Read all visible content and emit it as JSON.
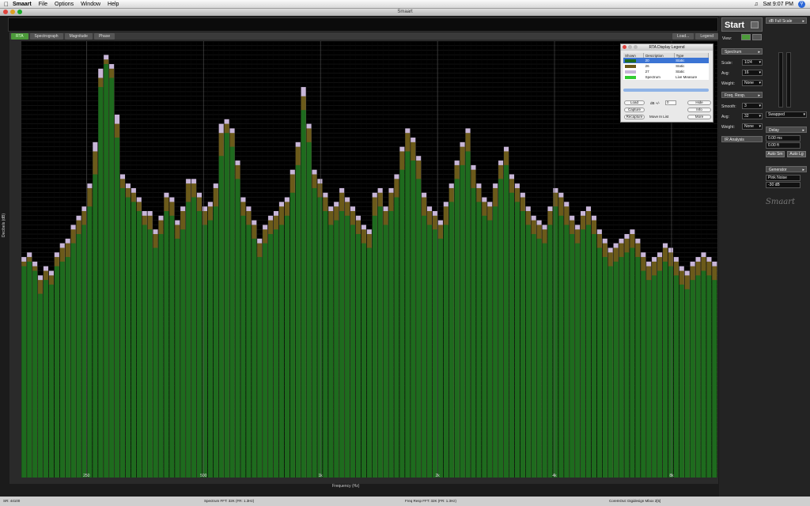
{
  "menubar": {
    "app": "Smaart",
    "items": [
      "File",
      "Options",
      "Window",
      "Help"
    ],
    "clock": "Sat 9:07 PM"
  },
  "window": {
    "title": "Smaart"
  },
  "tabs": {
    "items": [
      "RTA",
      "Spectrograph",
      "Magnitude",
      "Phase"
    ],
    "right": [
      "Load...",
      "Legend"
    ]
  },
  "plot": {
    "ylabel": "Decibels (dB)",
    "xlabel": "Frequency (Hz)",
    "xticks": [
      {
        "label": "250",
        "freq": 250
      },
      {
        "label": "500",
        "freq": 500
      },
      {
        "label": "1k",
        "freq": 1000
      },
      {
        "label": "2k",
        "freq": 2000
      },
      {
        "label": "4k",
        "freq": 4000
      },
      {
        "label": "8k",
        "freq": 8000
      }
    ]
  },
  "chart_data": {
    "type": "bar",
    "xscale": "log",
    "xlim": [
      170,
      10500
    ],
    "ylim": [
      -95,
      0
    ],
    "grid": true,
    "series": [
      {
        "name": "20",
        "color": "#1e6b1e"
      },
      {
        "name": "26",
        "color": "#6b5a1a"
      },
      {
        "name": "27",
        "color": "#c8b6d8"
      },
      {
        "name": "Spectrum",
        "color": "#33cc33"
      }
    ],
    "values_db": [
      -49,
      -48,
      -50,
      -55,
      -52,
      -53,
      -49,
      -48,
      -47,
      -44,
      -42,
      -40,
      -36,
      -29,
      -10,
      -5,
      -8,
      -21,
      -32,
      -34,
      -35,
      -37,
      -40,
      -41,
      -45,
      -42,
      -37,
      -38,
      -43,
      -41,
      -35,
      -34,
      -37,
      -40,
      -39,
      -36,
      -25,
      -20,
      -23,
      -30,
      -38,
      -40,
      -43,
      -47,
      -44,
      -42,
      -41,
      -40,
      -38,
      -33,
      -27,
      -15,
      -22,
      -32,
      -34,
      -37,
      -40,
      -39,
      -37,
      -38,
      -40,
      -42,
      -44,
      -45,
      -38,
      -36,
      -40,
      -37,
      -34,
      -28,
      -24,
      -26,
      -30,
      -38,
      -40,
      -41,
      -43,
      -40,
      -35,
      -30,
      -27,
      -24,
      -32,
      -35,
      -38,
      -39,
      -36,
      -30,
      -27,
      -33,
      -35,
      -37,
      -40,
      -42,
      -43,
      -44,
      -40,
      -36,
      -38,
      -40,
      -42,
      -44,
      -41,
      -40,
      -42,
      -45,
      -47,
      -49,
      -48,
      -47,
      -46,
      -45,
      -47,
      -50,
      -52,
      -51,
      -50,
      -48,
      -49,
      -51,
      -53,
      -54,
      -52,
      -51,
      -50,
      -51,
      -52
    ],
    "olive_db": [
      -48,
      -47,
      -49,
      -52,
      -50,
      -51,
      -47,
      -45,
      -44,
      -41,
      -39,
      -37,
      -32,
      -24,
      -8,
      -4,
      -6,
      -18,
      -30,
      -32,
      -33,
      -35,
      -38,
      -38,
      -42,
      -39,
      -34,
      -35,
      -40,
      -37,
      -31,
      -31,
      -34,
      -37,
      -36,
      -32,
      -20,
      -18,
      -20,
      -27,
      -35,
      -37,
      -40,
      -44,
      -41,
      -39,
      -38,
      -36,
      -35,
      -29,
      -23,
      -12,
      -19,
      -29,
      -31,
      -34,
      -37,
      -36,
      -33,
      -35,
      -37,
      -39,
      -41,
      -42,
      -34,
      -33,
      -37,
      -33,
      -30,
      -24,
      -20,
      -22,
      -26,
      -34,
      -37,
      -38,
      -40,
      -36,
      -32,
      -27,
      -23,
      -20,
      -28,
      -32,
      -35,
      -36,
      -32,
      -27,
      -24,
      -30,
      -32,
      -34,
      -37,
      -39,
      -40,
      -41,
      -37,
      -33,
      -34,
      -36,
      -39,
      -41,
      -38,
      -37,
      -39,
      -42,
      -44,
      -46,
      -45,
      -44,
      -43,
      -42,
      -44,
      -47,
      -49,
      -48,
      -47,
      -45,
      -46,
      -48,
      -50,
      -51,
      -49,
      -48,
      -47,
      -48,
      -49
    ],
    "peak_db": [
      -47,
      -46,
      -48,
      -51,
      -49,
      -50,
      -46,
      -44,
      -43,
      -40,
      -38,
      -36,
      -31,
      -22,
      -6,
      -3,
      -5,
      -16,
      -29,
      -31,
      -32,
      -34,
      -37,
      -37,
      -41,
      -38,
      -33,
      -34,
      -39,
      -36,
      -30,
      -30,
      -33,
      -36,
      -35,
      -31,
      -18,
      -17,
      -19,
      -26,
      -34,
      -36,
      -39,
      -43,
      -40,
      -38,
      -37,
      -35,
      -34,
      -28,
      -22,
      -10,
      -18,
      -28,
      -30,
      -33,
      -36,
      -35,
      -32,
      -34,
      -36,
      -38,
      -40,
      -41,
      -33,
      -32,
      -36,
      -32,
      -29,
      -23,
      -19,
      -21,
      -25,
      -33,
      -36,
      -37,
      -39,
      -35,
      -31,
      -26,
      -22,
      -19,
      -27,
      -31,
      -34,
      -35,
      -31,
      -26,
      -23,
      -29,
      -31,
      -33,
      -36,
      -38,
      -39,
      -40,
      -36,
      -32,
      -33,
      -35,
      -38,
      -40,
      -37,
      -36,
      -38,
      -41,
      -43,
      -45,
      -44,
      -43,
      -42,
      -41,
      -43,
      -46,
      -48,
      -47,
      -46,
      -44,
      -45,
      -47,
      -49,
      -50,
      -48,
      -47,
      -46,
      -47,
      -48
    ]
  },
  "right": {
    "start": "Start",
    "view_label": "View:",
    "spectrum_head": "Spectrum",
    "scale_label": "Scale:",
    "scale_val": "1/24",
    "avg_label": "Avg:",
    "avg_val": "16",
    "weight_label": "Weight:",
    "weight_val": "None",
    "freq_head": "Freq. Resp.",
    "smooth_label": "Smooth:",
    "smooth_val": "3",
    "avg2_label": "Avg:",
    "avg2_val": "32",
    "weight2_label": "Weight:",
    "weight2_val": "None",
    "ir_head": "IR Analysis",
    "dbfs_head": "dB Full Scale",
    "swapped": "Swapped",
    "delay_head": "Delay",
    "delay_ms": "0.00 ms",
    "delay_ft": "0.00 ft",
    "auto_sm": "Auto Sm",
    "auto_lg": "Auto Lg",
    "gen_head": "Generator",
    "gen_signal": "Pink Noise",
    "gen_level": "-30 dB",
    "logo": "Smaart"
  },
  "legend": {
    "title": "RTA Display Legend",
    "cols": [
      "Shown",
      "Description",
      "Type"
    ],
    "rows": [
      {
        "desc": "20",
        "type": "Static",
        "color": "#1e6b1e"
      },
      {
        "desc": "26",
        "type": "Static",
        "color": "#6b5a1a"
      },
      {
        "desc": "27",
        "type": "Static",
        "color": "#c8b6d8"
      },
      {
        "desc": "Spectrum",
        "type": "Live Measure",
        "color": "#33cc33"
      }
    ],
    "buttons": {
      "load": "Load",
      "capture": "Capture",
      "recapture": "Recapture",
      "db": "dB +/-",
      "db_val": "0",
      "move": "Move In List",
      "hide": "Hide",
      "info": "Info",
      "more": "More"
    }
  },
  "status": {
    "sr": "SR: 44100",
    "spectrum_fft": "Spectrum FFT: 32K (FR: 1.3Hz)",
    "freqresp_fft": "Freq Resp FFT: 32K (FR: 1.3Hz)",
    "device": "CoreInOut: Digidesign Mbox 2[5]"
  }
}
